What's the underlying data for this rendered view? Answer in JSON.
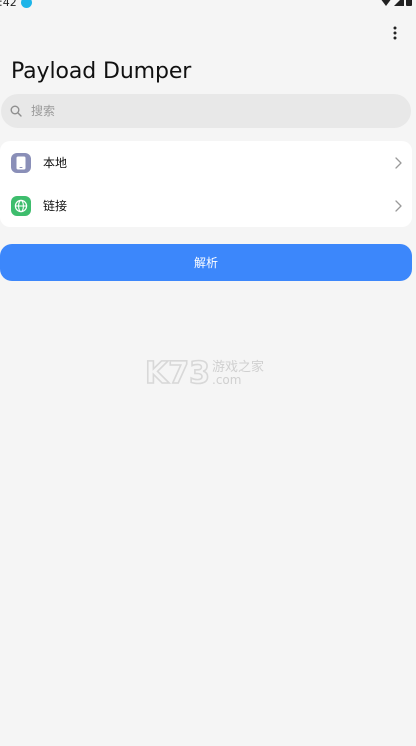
{
  "status_bar": {
    "time": ":42"
  },
  "app": {
    "title": "Payload Dumper"
  },
  "search": {
    "placeholder": "搜索"
  },
  "list": {
    "items": [
      {
        "label": "本地",
        "icon": "phone-icon"
      },
      {
        "label": "链接",
        "icon": "globe-icon"
      }
    ]
  },
  "actions": {
    "parse_label": "解析"
  },
  "watermark": {
    "brand": "K73",
    "tagline": "游戏之家",
    "domain": ".com"
  },
  "colors": {
    "accent": "#3c87fb",
    "background": "#f5f5f5",
    "search_bg": "#e8e8e8",
    "local_icon_bg": "#8a8fb8",
    "link_icon_bg": "#3ebd6d"
  }
}
